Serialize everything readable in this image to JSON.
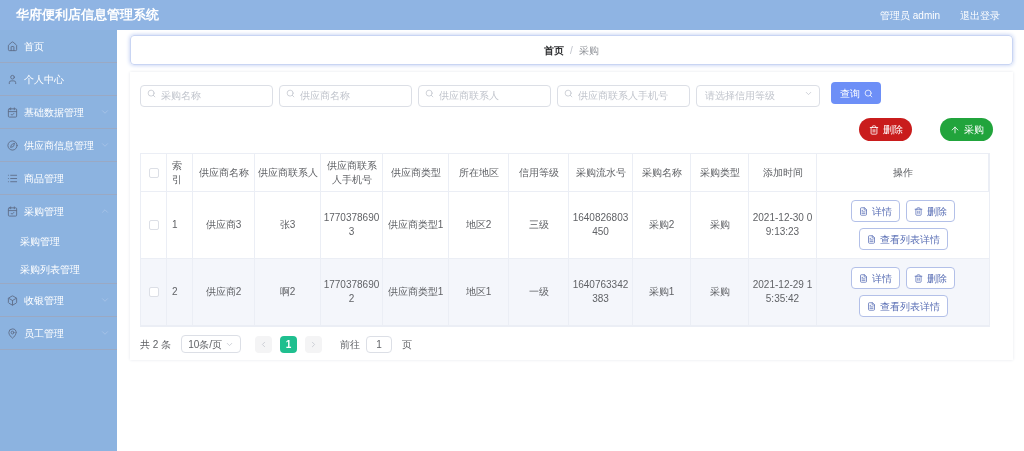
{
  "header": {
    "title": "华府便利店信息管理系统",
    "user": "管理员 admin",
    "logout": "退出登录"
  },
  "sidebar": {
    "items": [
      {
        "label": "首页"
      },
      {
        "label": "个人中心"
      },
      {
        "label": "基础数据管理",
        "expanded": false
      },
      {
        "label": "供应商信息管理",
        "expanded": false
      },
      {
        "label": "商品管理"
      },
      {
        "label": "采购管理",
        "expanded": true,
        "children": [
          {
            "label": "采购管理"
          },
          {
            "label": "采购列表管理"
          }
        ]
      },
      {
        "label": "收银管理",
        "expanded": false
      },
      {
        "label": "员工管理",
        "expanded": false
      }
    ]
  },
  "breadcrumb": {
    "items": [
      "首页",
      "采购"
    ],
    "separator": "/"
  },
  "search": {
    "fields": [
      {
        "placeholder": "采购名称"
      },
      {
        "placeholder": "供应商名称"
      },
      {
        "placeholder": "供应商联系人"
      },
      {
        "placeholder": "供应商联系人手机号"
      }
    ],
    "select": {
      "placeholder": "请选择信用等级"
    },
    "button": "查询"
  },
  "actions": [
    {
      "label": "删除",
      "kind": "delete"
    },
    {
      "label": "采购",
      "kind": "add"
    }
  ],
  "table": {
    "all_checked": false,
    "columns": [
      "索引",
      "供应商名称",
      "供应商联系人",
      "供应商联系人手机号",
      "供应商类型",
      "所在地区",
      "信用等级",
      "采购流水号",
      "采购名称",
      "采购类型",
      "添加时间",
      "操作"
    ],
    "rows": [
      {
        "checked": false,
        "cells": [
          "1",
          "供应商3",
          "张3",
          "17703786903",
          "供应商类型1",
          "地区2",
          "三级",
          "1640826803450",
          "采购2",
          "采购",
          "2021-12-30 09:13:23"
        ],
        "buttons": [
          "详情",
          "删除",
          "查看列表详情"
        ]
      },
      {
        "checked": false,
        "cells": [
          "2",
          "供应商2",
          "啊2",
          "17703786902",
          "供应商类型1",
          "地区1",
          "一级",
          "1640763342383",
          "采购1",
          "采购",
          "2021-12-29 15:35:42"
        ],
        "buttons": [
          "详情",
          "删除",
          "查看列表详情"
        ]
      }
    ]
  },
  "pagination": {
    "total": "共 2 条",
    "page_size": "10条/页",
    "pages": [
      {
        "label": "1",
        "selected": true
      }
    ],
    "goto_label": "前往",
    "goto_value": "1",
    "goto_unit": "页"
  }
}
